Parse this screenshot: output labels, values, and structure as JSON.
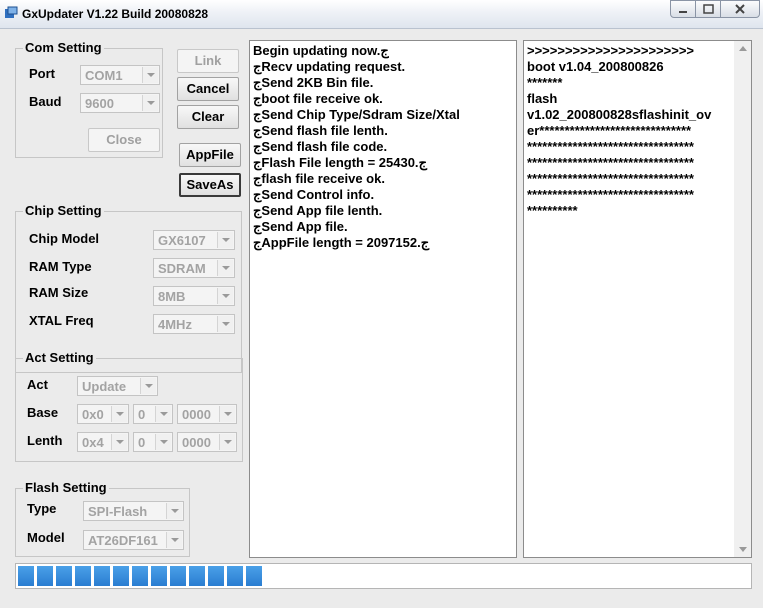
{
  "window": {
    "title": "GxUpdater V1.22 Build 20080828"
  },
  "com_setting": {
    "legend": "Com Setting",
    "port_label": "Port",
    "port_value": "COM1",
    "baud_label": "Baud",
    "baud_value": "9600",
    "close_label": "Close"
  },
  "buttons": {
    "link": "Link",
    "cancel": "Cancel",
    "clear": "Clear",
    "appfile": "AppFile",
    "saveas": "SaveAs"
  },
  "chip_setting": {
    "legend": "Chip Setting",
    "chip_model_label": "Chip Model",
    "chip_model_value": "GX6107",
    "ram_type_label": "RAM Type",
    "ram_type_value": "SDRAM",
    "ram_size_label": "RAM Size",
    "ram_size_value": "8MB",
    "xtal_label": "XTAL Freq",
    "xtal_value": "4MHz"
  },
  "act_setting": {
    "legend": "Act Setting",
    "act_label": "Act",
    "act_value": "Update",
    "base_label": "Base",
    "base_values": [
      "0x0",
      "0",
      "0000"
    ],
    "lenth_label": "Lenth",
    "lenth_values": [
      "0x4",
      "0",
      "0000"
    ]
  },
  "flash_setting": {
    "legend": "Flash Setting",
    "type_label": "Type",
    "type_value": "SPI-Flash",
    "model_label": "Model",
    "model_value": "AT26DF161"
  },
  "log_left": [
    "Begin updating now.ج",
    "جRecv updating request.",
    "جSend 2KB Bin file.",
    "جboot file receive ok.",
    "جSend Chip Type/Sdram Size/Xtal",
    "جSend flash file lenth.",
    "جSend flash file code.",
    "جFlash File length = 25430.ج",
    "جflash file receive ok.",
    "جSend Control info.",
    "جSend App file lenth.",
    "جSend App file.",
    "جAppFile length = 2097152.ج"
  ],
  "log_right": [
    ">>>>>>>>>>>>>>>>>>>>>>",
    "boot v1.04_200800826",
    "*******",
    "flash",
    "v1.02_200800828sflashinit_ov",
    "er******************************",
    "*********************************",
    "*********************************",
    "*********************************",
    "*********************************",
    "**********"
  ],
  "progress": {
    "fraction": 0.36,
    "color": "#2a7dd1"
  }
}
